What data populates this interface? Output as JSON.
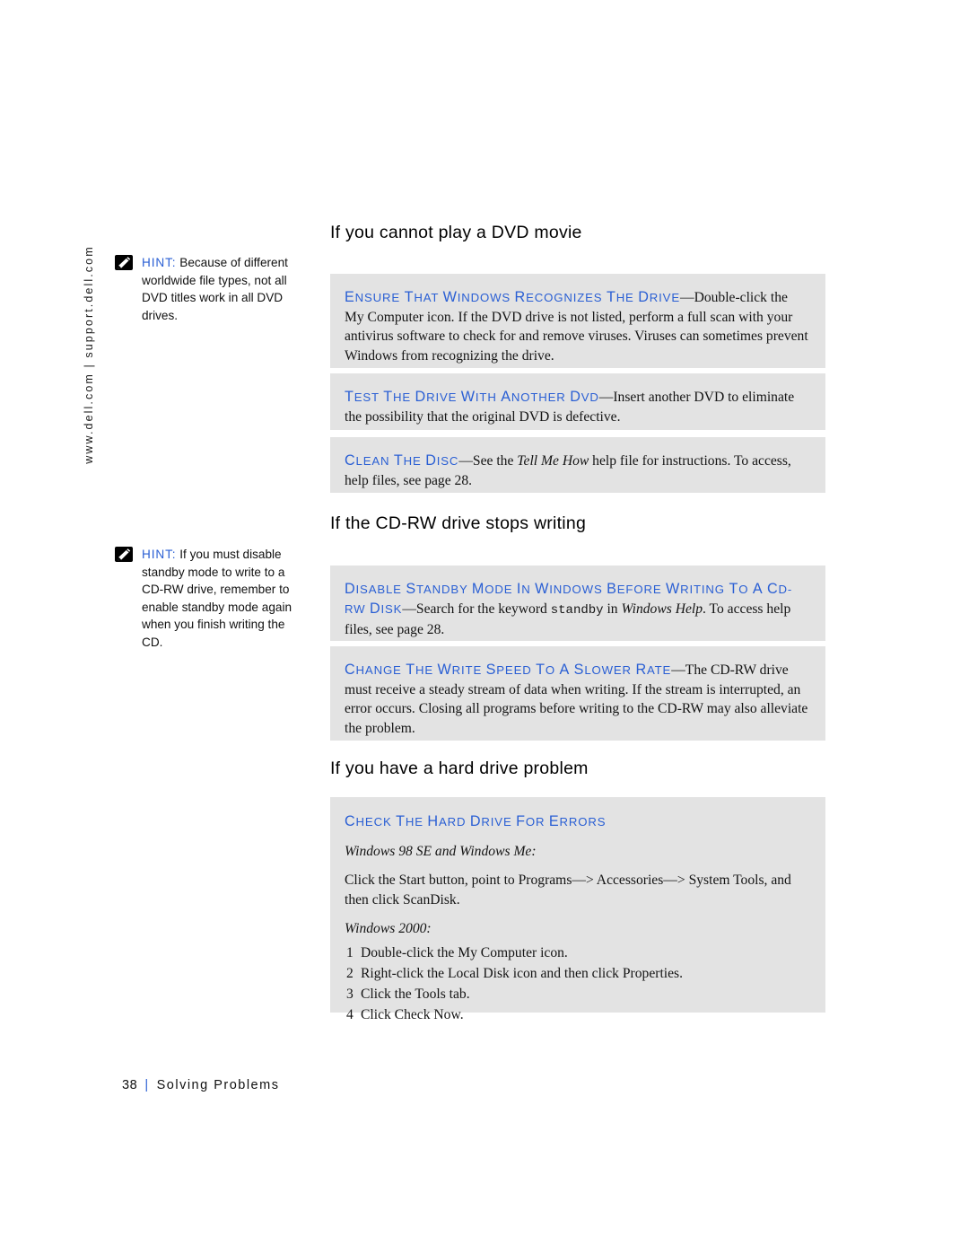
{
  "page": {
    "spine_url": "www.dell.com | support.dell.com",
    "footer_page_number": "38",
    "footer_separator": "|",
    "footer_section": "Solving Problems",
    "accent_blue": "#2a5fd4",
    "box_background": "#e3e3e3"
  },
  "hints": [
    {
      "icon": "pencil-note-icon",
      "label": "HINT:",
      "text": " Because of different worldwide file types, not all DVD titles work in all DVD drives."
    },
    {
      "icon": "pencil-note-icon",
      "label": "HINT:",
      "text": " If you must disable standby mode to write to a CD-RW drive, remember to enable standby mode again when you finish writing the CD."
    }
  ],
  "sections": [
    {
      "heading": "If you cannot play a DVD movie",
      "boxes": [
        {
          "lead_cap": "E",
          "lead_rest": "NSURE THAT ",
          "lead_cap2": "W",
          "lead_rest2": "INDOWS RECOGNIZES THE DRIVE",
          "lead_full": "ENSURE THAT WINDOWS RECOGNIZES THE DRIVE",
          "dash": "—",
          "body": "Double-click the My Computer icon. If the DVD drive is not listed, perform a full scan with your antivirus software to check for and remove viruses. Viruses can sometimes prevent Windows from recognizing the drive."
        },
        {
          "lead_full": "TEST THE DRIVE WITH ANOTHER DVD",
          "dash": "—",
          "body": "Insert another DVD to eliminate the possibility that the original DVD is defective."
        },
        {
          "lead_full": "CLEAN THE DISC",
          "dash": "—",
          "body_pre": "See the ",
          "body_italic": "Tell Me How",
          "body_post": " help file for instructions. To access, help files, see page 28."
        }
      ]
    },
    {
      "heading": "If the CD-RW drive stops writing",
      "boxes": [
        {
          "lead_full": "DISABLE STANDBY MODE IN WINDOWS BEFORE WRITING TO A CD-RW DISK",
          "dash": "—",
          "body_pre": "Search for the keyword ",
          "body_mono": "standby",
          "body_mid": " in ",
          "body_italic": "Windows Help",
          "body_post": ". To access help files, see page 28."
        },
        {
          "lead_full": "CHANGE THE WRITE SPEED TO A SLOWER RATE",
          "dash": "—",
          "body": "The CD-RW drive must receive a steady stream of data when writing. If the stream is interrupted, an error occurs. Closing all programs before writing to the CD-RW may also alleviate the problem."
        }
      ]
    },
    {
      "heading": "If you have a hard drive problem",
      "boxes": [
        {
          "lead_full": "CHECK THE HARD DRIVE FOR ERRORS",
          "sub1": "Windows 98 SE and Windows Me:",
          "para1": "Click the Start button, point to Programs—>  Accessories—>  System Tools, and then click ScanDisk.",
          "sub2": "Windows 2000:",
          "steps": [
            {
              "num": "1",
              "text": "Double-click the My Computer icon."
            },
            {
              "num": "2",
              "text": "Right-click the Local Disk icon and then click Properties."
            },
            {
              "num": "3",
              "text": "Click the Tools tab."
            },
            {
              "num": "4",
              "text": "Click Check Now."
            }
          ]
        }
      ]
    }
  ]
}
